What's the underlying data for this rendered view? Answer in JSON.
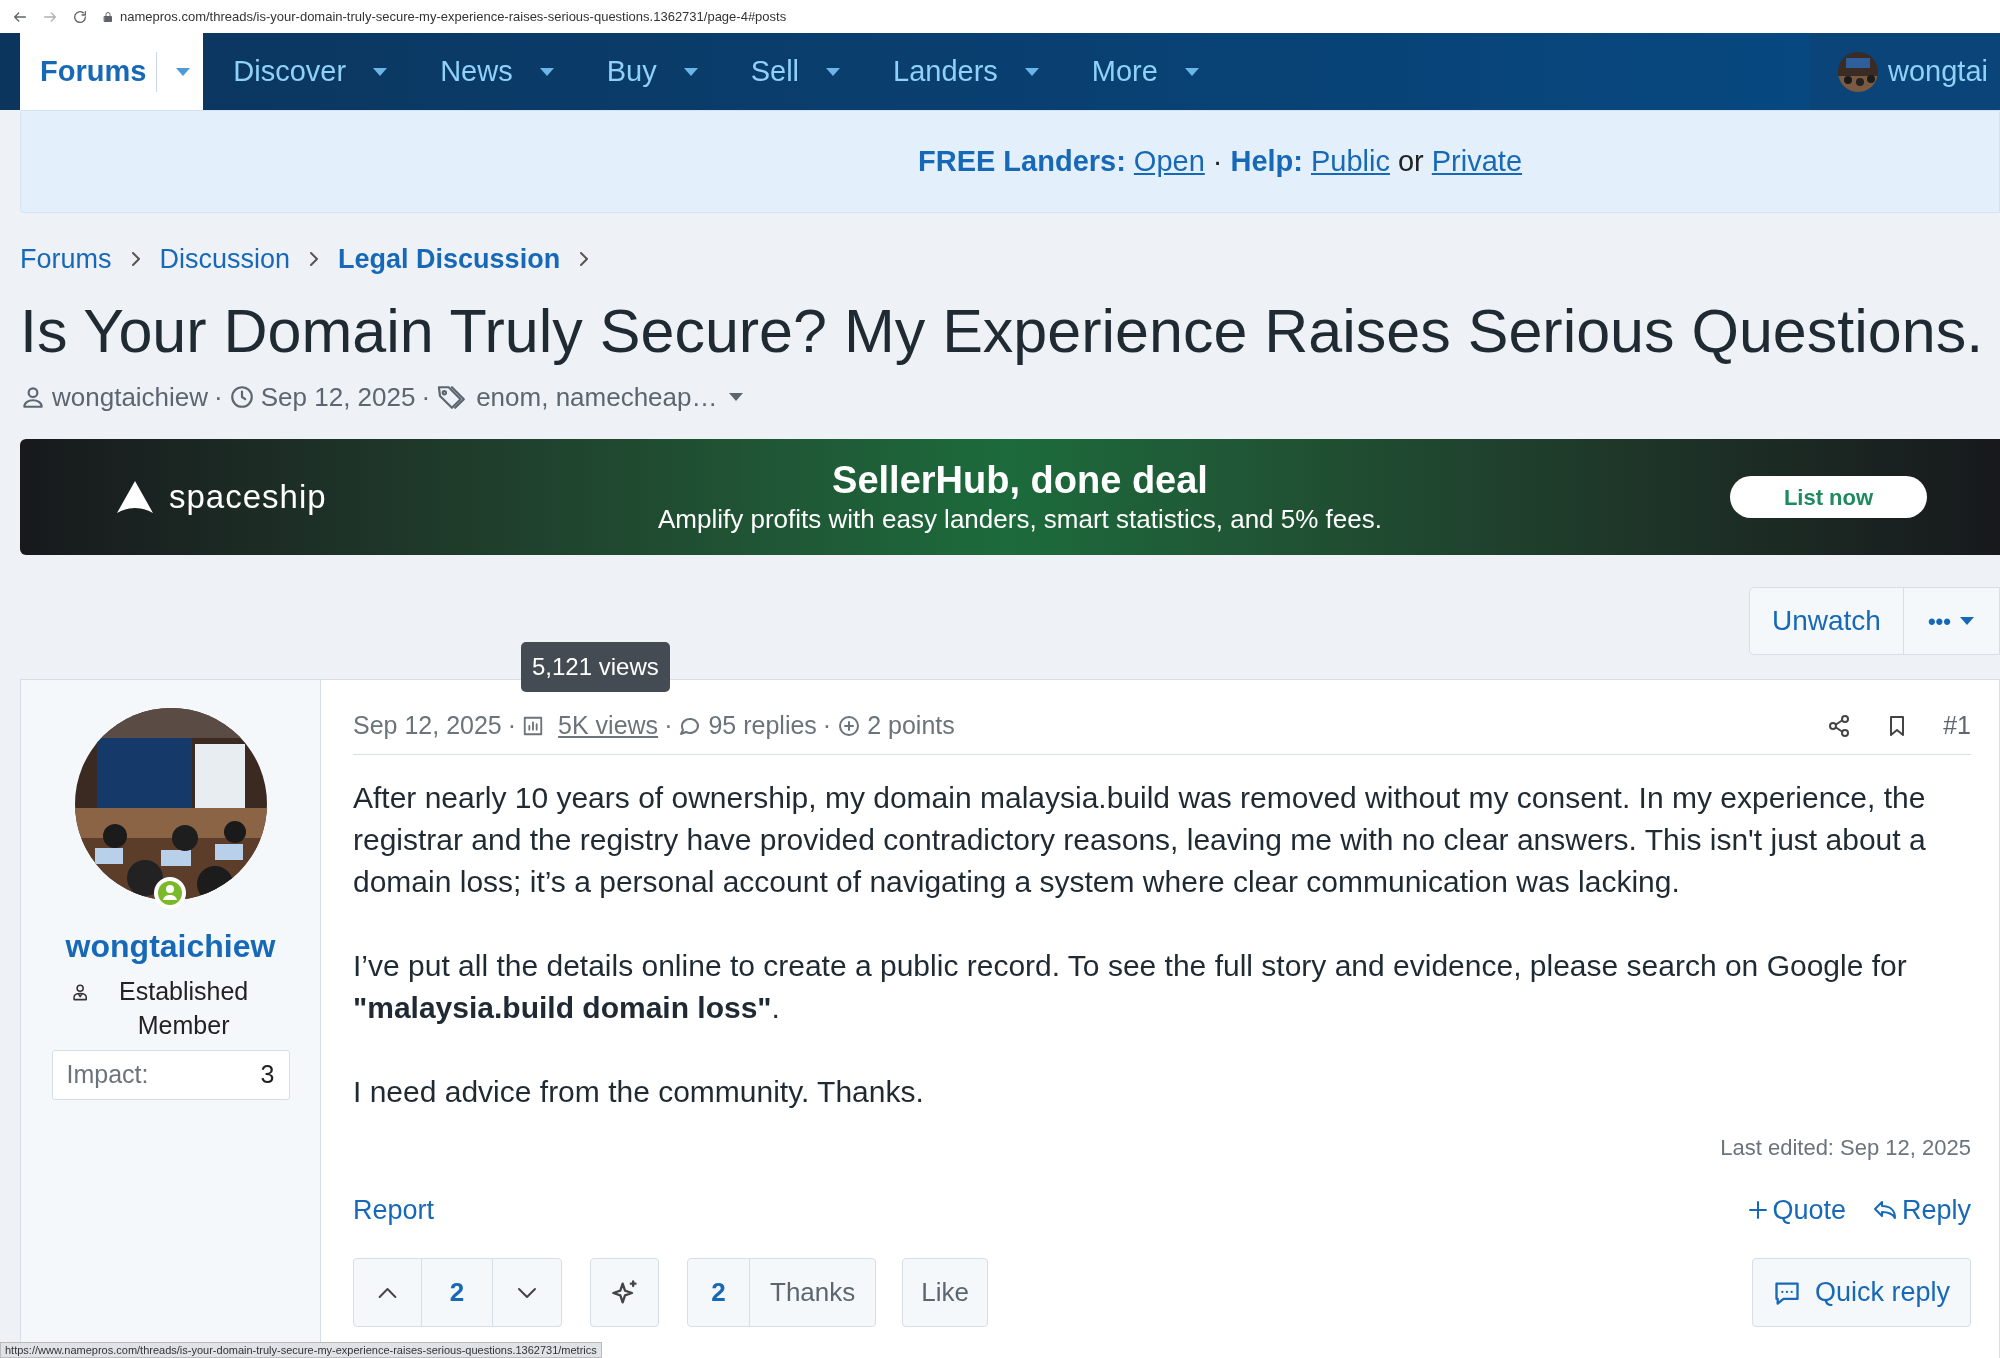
{
  "browser": {
    "url": "namepros.com/threads/is-your-domain-truly-secure-my-experience-raises-serious-questions.1362731/page-4#posts",
    "status_url": "https://www.namepros.com/threads/is-your-domain-truly-secure-my-experience-raises-serious-questions.1362731/metrics"
  },
  "nav": {
    "items": [
      {
        "label": "Forums",
        "selected": true
      },
      {
        "label": "Discover",
        "selected": false
      },
      {
        "label": "News",
        "selected": false
      },
      {
        "label": "Buy",
        "selected": false
      },
      {
        "label": "Sell",
        "selected": false
      },
      {
        "label": "Landers",
        "selected": false
      },
      {
        "label": "More",
        "selected": false
      }
    ],
    "user": {
      "name": "wongtai"
    }
  },
  "notice": [
    {
      "kind": "label",
      "text": "FREE Landers:"
    },
    {
      "kind": "link",
      "text": "Open"
    },
    {
      "kind": "text",
      "text": "·"
    },
    {
      "kind": "label",
      "text": "Help:"
    },
    {
      "kind": "link",
      "text": "Public"
    },
    {
      "kind": "text",
      "text": "or"
    },
    {
      "kind": "link",
      "text": "Private"
    }
  ],
  "breadcrumb": [
    {
      "label": "Forums",
      "current": false
    },
    {
      "label": "Discussion",
      "current": false
    },
    {
      "label": "Legal Discussion",
      "current": true
    }
  ],
  "thread": {
    "title": "Is Your Domain Truly Secure? My Experience Raises Serious Questions.",
    "author": "wongtaichiew",
    "date": "Sep 12, 2025",
    "tags": "enom, namecheap…",
    "separators": [
      "·",
      "·"
    ]
  },
  "ad": {
    "brand": "spaceship",
    "headline": "SellerHub, done deal",
    "subline": "Amplify profits with easy landers, smart statistics, and 5% fees.",
    "button": "List now"
  },
  "thread_actions": {
    "unwatch": "Unwatch",
    "more": "•••"
  },
  "post": {
    "tooltip": "5,121 views",
    "separators": [
      "·",
      "·",
      "·"
    ],
    "date": "Sep 12, 2025",
    "views": "5K views",
    "replies": "95 replies",
    "points": "2 points",
    "number": "#1",
    "author": {
      "name": "wongtaichiew",
      "title": "Established Member",
      "online": true,
      "impact_label": "Impact:",
      "impact_value": "3"
    },
    "paragraphs": [
      "After nearly 10 years of ownership, my domain malaysia.build was removed without my consent. In my experience, the registrar and the registry have provided contradictory reasons, leaving me with no clear answers. This isn't just about a domain loss; it’s a personal account of navigating a system where clear communication was lacking.",
      "I’ve put all the details online to create a public record. To see the full story and evidence, please search on Google for **\"malaysia.build domain loss\"**.",
      "I need advice from the community. Thanks."
    ],
    "last_edited": "Last edited: Sep 12, 2025",
    "report": "Report",
    "quote": "Quote",
    "reply": "Reply",
    "votes": "2",
    "thanks_count": "2",
    "thanks": "Thanks",
    "like": "Like",
    "quick_reply": "Quick reply"
  }
}
